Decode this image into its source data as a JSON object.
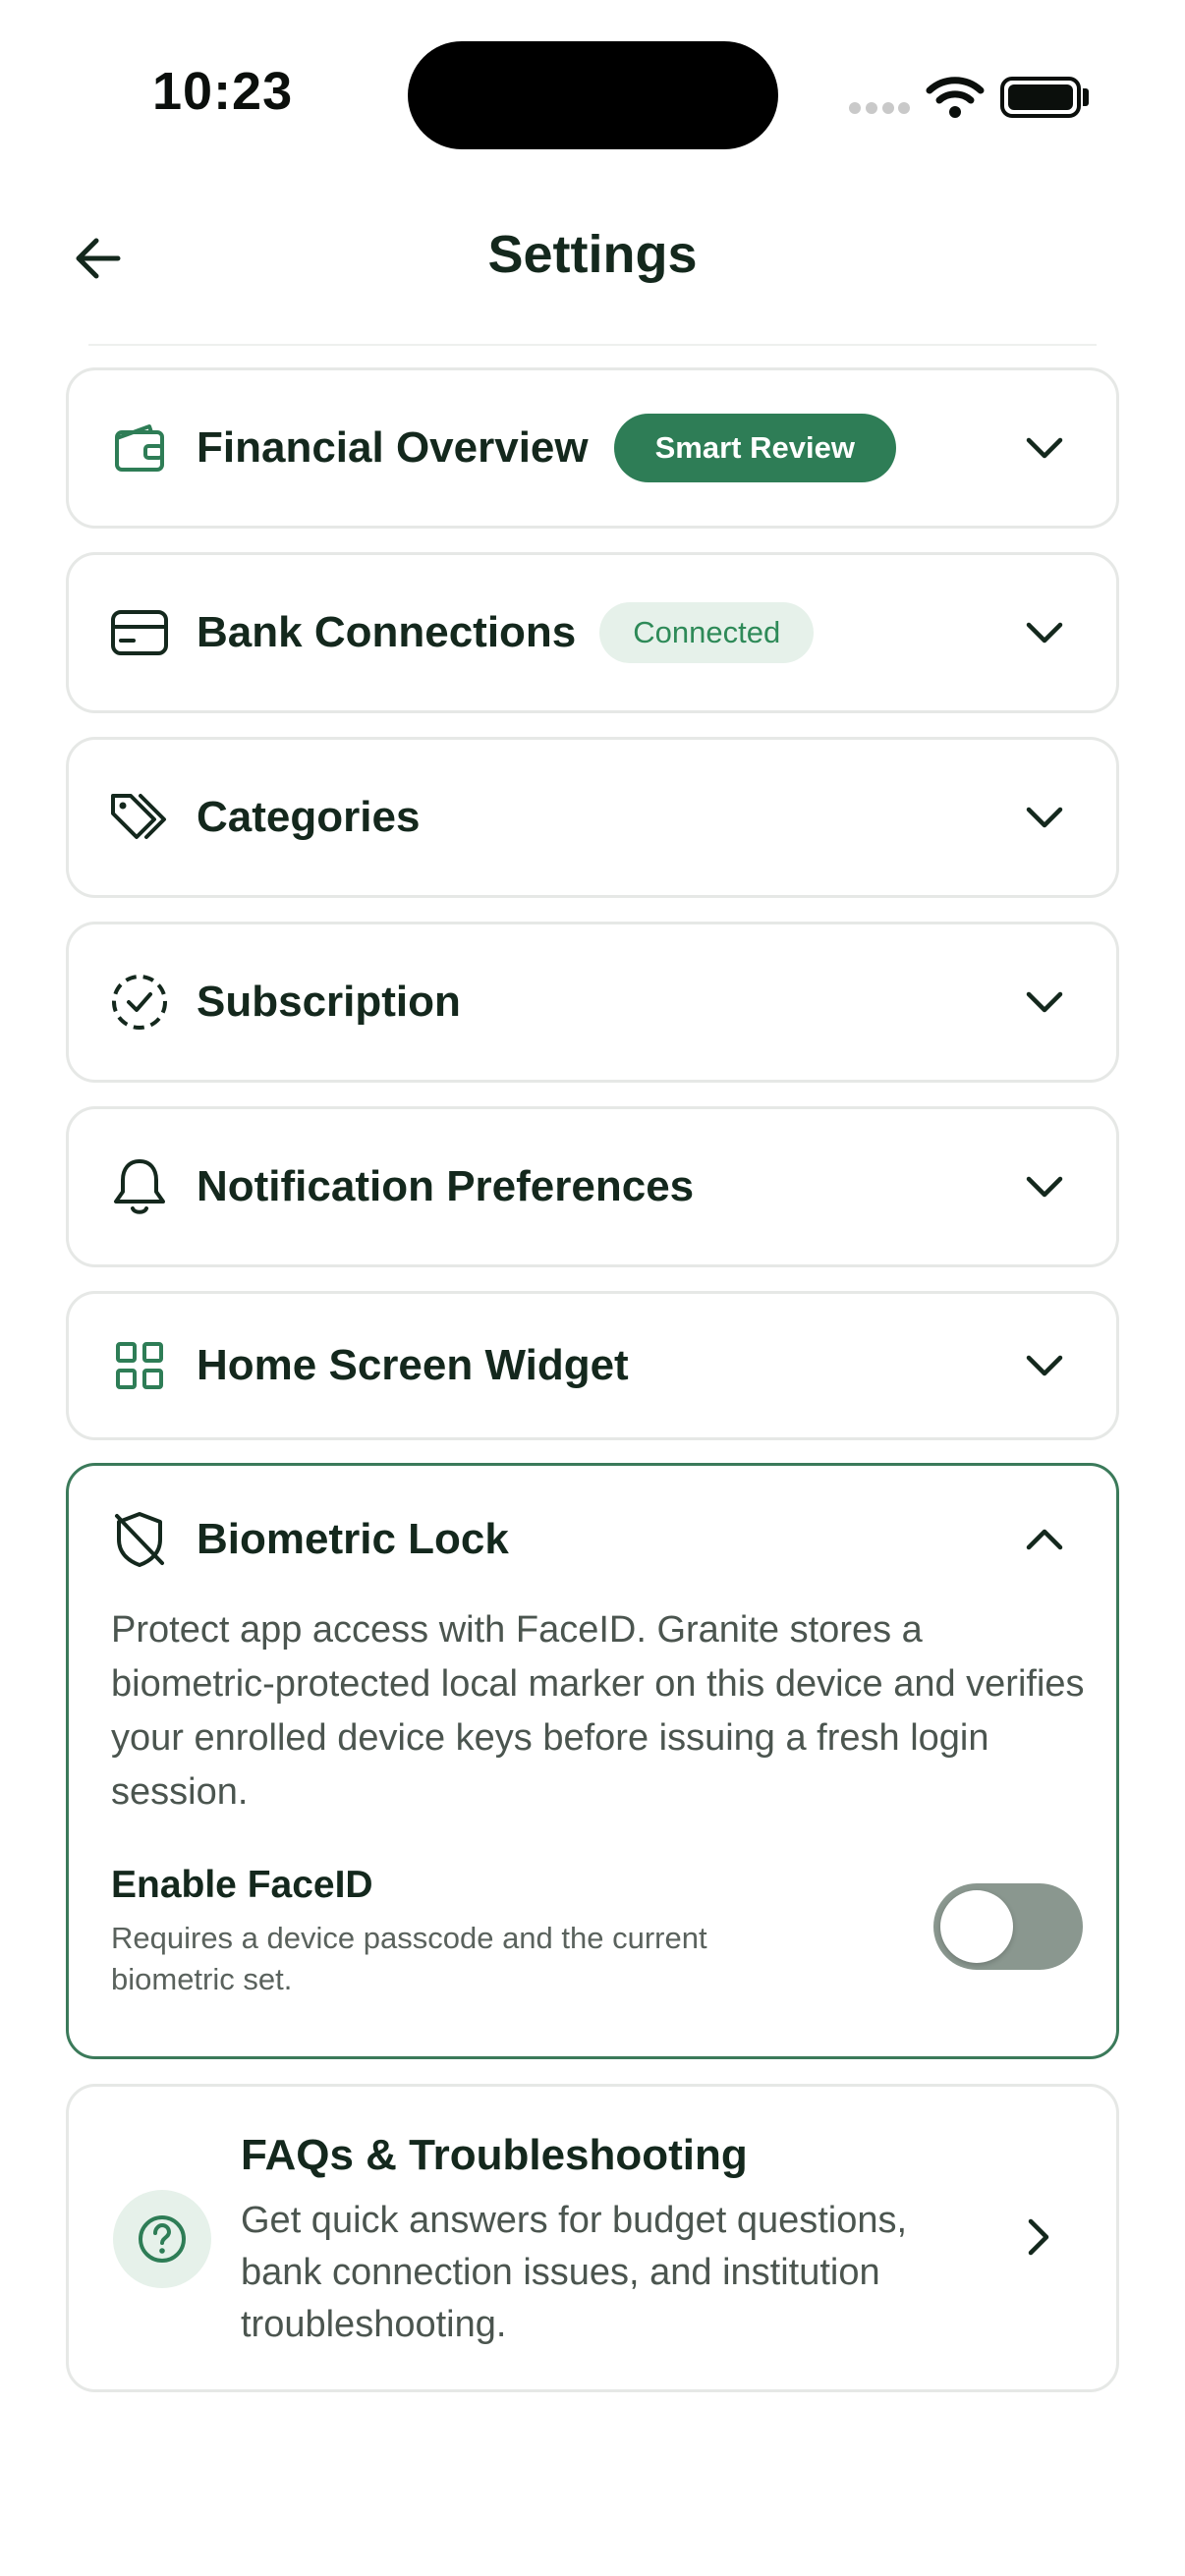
{
  "status_bar": {
    "time": "10:23"
  },
  "header": {
    "title": "Settings"
  },
  "sections": [
    {
      "label": "Financial Overview",
      "badge": "Smart Review",
      "icon": "wallet-icon"
    },
    {
      "label": "Bank Connections",
      "badge": "Connected",
      "icon": "card-icon"
    },
    {
      "label": "Categories",
      "icon": "tags-icon"
    },
    {
      "label": "Subscription",
      "icon": "dashed-check-circle-icon"
    },
    {
      "label": "Notification Preferences",
      "icon": "bell-icon"
    },
    {
      "label": "Home Screen Widget",
      "icon": "grid-icon"
    }
  ],
  "biometric": {
    "label": "Biometric Lock",
    "icon": "shield-off-icon",
    "description": "Protect app access with FaceID. Granite stores a biometric-protected local marker on this device and verifies your enrolled device keys before issuing a fresh login session.",
    "option_title": "Enable FaceID",
    "option_subtitle": "Requires a device passcode and the current biometric set.",
    "enabled": false
  },
  "faq": {
    "title": "FAQs & Troubleshooting",
    "description": "Get quick answers for budget questions, bank connection issues, and institution troubleshooting."
  },
  "colors": {
    "accent": "#2e7d56",
    "text": "#14281d",
    "border": "#e6e8e6",
    "soft_badge": "#e6f1ea"
  }
}
